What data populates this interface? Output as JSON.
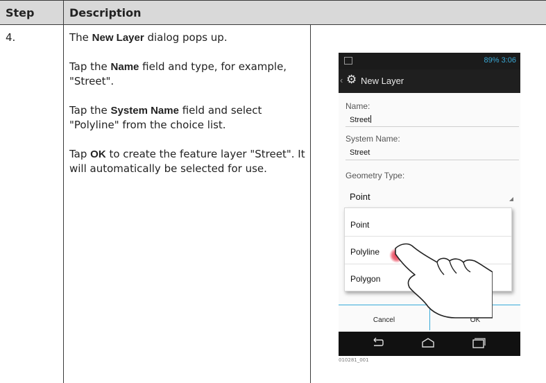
{
  "table": {
    "header": {
      "step": "Step",
      "description": "Description"
    },
    "row": {
      "step": "4.",
      "paragraphs": [
        {
          "before": "The ",
          "bold": "New Layer",
          "after": " dialog pops up."
        },
        {
          "before": "Tap the ",
          "bold": "Name",
          "after": " field and type, for example, \"Street\"."
        },
        {
          "before": "Tap the ",
          "bold": "System Name",
          "after": " field and select \"Polyline\" from the choice list."
        },
        {
          "before": "Tap ",
          "bold": "OK",
          "after": " to create the feature layer \"Street\". It will automatically be selected for use."
        }
      ]
    }
  },
  "phone": {
    "status": {
      "text": "89%  3:06"
    },
    "actionbar": {
      "title": "New Layer",
      "icon": "gear-icon"
    },
    "form": {
      "name_label": "Name:",
      "name_value": "Street",
      "system_name_label": "System Name:",
      "system_name_value": "Street",
      "geometry_label": "Geometry Type:",
      "geometry_value": "Point"
    },
    "dropdown": {
      "options": [
        "Point",
        "Polyline",
        "Polygon"
      ]
    },
    "buttons": {
      "cancel": "Cancel",
      "ok": "OK"
    },
    "colors": {
      "accent": "#35a9d8",
      "touch": "#e8384f"
    }
  },
  "figure_id": "010281_001"
}
